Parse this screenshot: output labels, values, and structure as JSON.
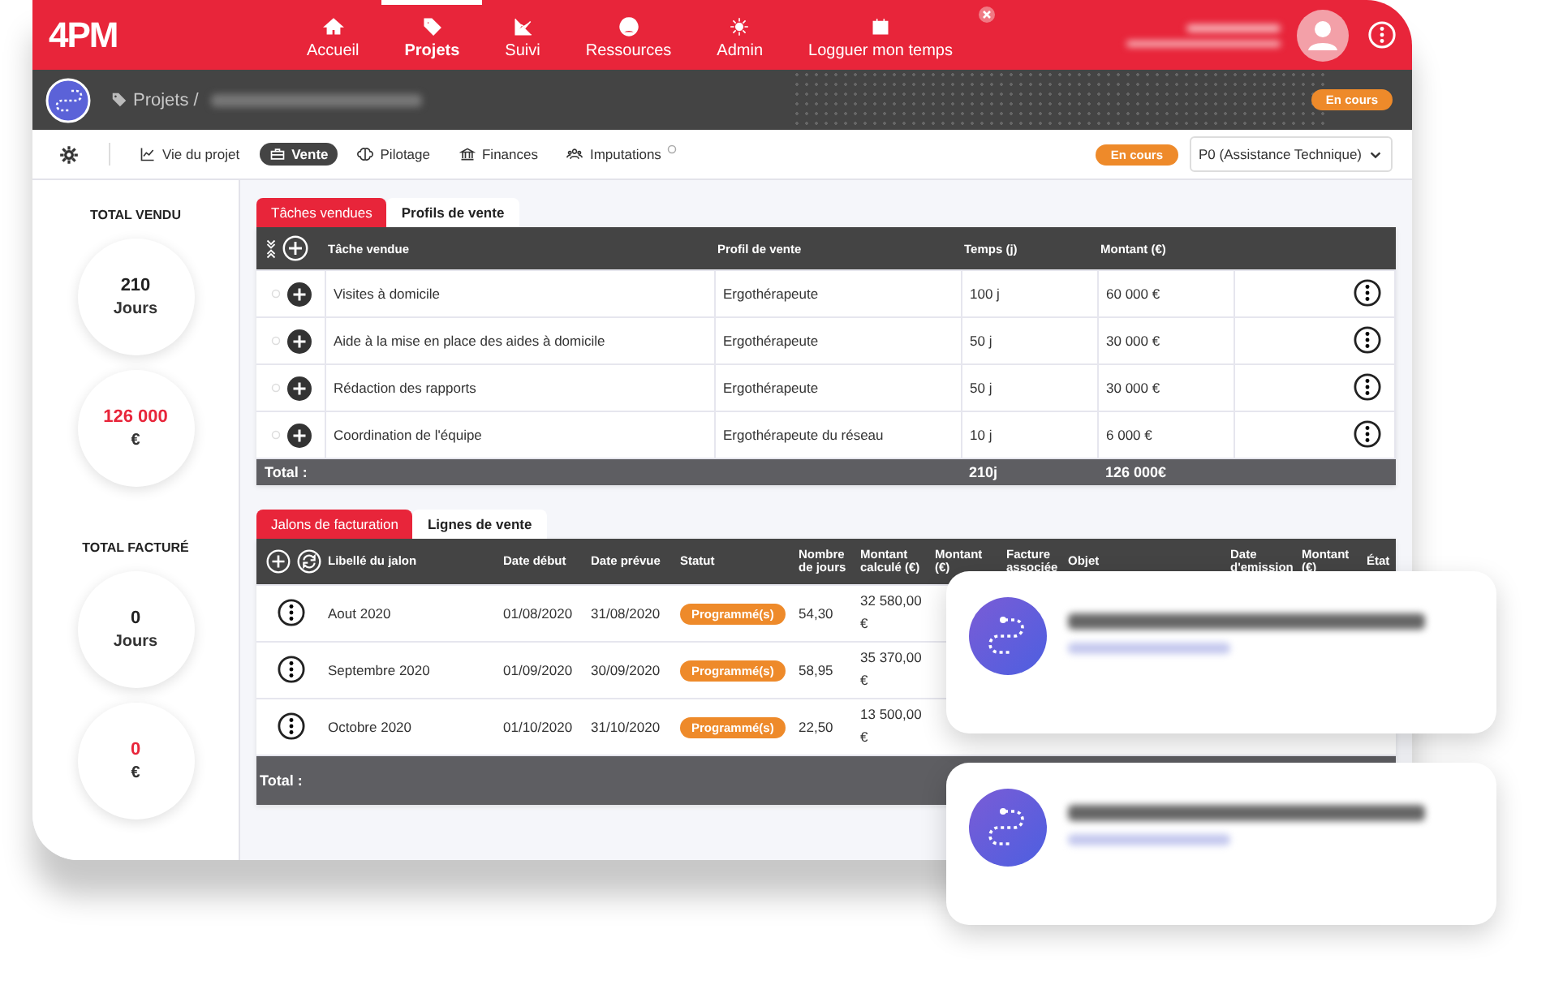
{
  "logo": "4PM",
  "nav": [
    {
      "label": "Accueil",
      "selected": false
    },
    {
      "label": "Projets",
      "selected": true
    },
    {
      "label": "Suivi",
      "selected": false
    },
    {
      "label": "Ressources",
      "selected": false
    },
    {
      "label": "Admin",
      "selected": false
    },
    {
      "label": "Logguer mon temps",
      "selected": false
    }
  ],
  "project_bar": {
    "breadcrumb": "Projets /",
    "status": "En cours"
  },
  "toolbar": {
    "tabs": [
      {
        "label": "Vie du projet",
        "selected": false
      },
      {
        "label": "Vente",
        "selected": true
      },
      {
        "label": "Pilotage",
        "selected": false
      },
      {
        "label": "Finances",
        "selected": false
      },
      {
        "label": "Imputations",
        "selected": false
      }
    ],
    "status": "En cours",
    "phase": "P0 (Assistance Technique)"
  },
  "sidebar": [
    {
      "title": "TOTAL VENDU",
      "stats": [
        {
          "value": "210",
          "unit": "Jours",
          "kind": "days"
        },
        {
          "value": "126 000",
          "unit": "€",
          "kind": "amount"
        }
      ]
    },
    {
      "title": "TOTAL FACTURÉ",
      "stats": [
        {
          "value": "0",
          "unit": "Jours",
          "kind": "days"
        },
        {
          "value": "0",
          "unit": "€",
          "kind": "amount"
        }
      ]
    }
  ],
  "sales": {
    "tabs": [
      {
        "label": "Tâches vendues",
        "selected": true
      },
      {
        "label": "Profils de vente",
        "selected": false
      }
    ],
    "columns": [
      "Tâche vendue",
      "Profil de vente",
      "Temps (j)",
      "Montant (€)"
    ],
    "rows": [
      {
        "task": "Visites à domicile",
        "profile": "Ergothérapeute",
        "time": "100 j",
        "amount": "60 000 €"
      },
      {
        "task": "Aide à la mise en place des aides à domicile",
        "profile": "Ergothérapeute",
        "time": "50 j",
        "amount": "30 000 €"
      },
      {
        "task": "Rédaction des rapports",
        "profile": "Ergothérapeute",
        "time": "50 j",
        "amount": "30 000 €"
      },
      {
        "task": "Coordination de l'équipe",
        "profile": "Ergothérapeute du réseau",
        "time": "10 j",
        "amount": "6 000 €"
      }
    ],
    "total": {
      "label": "Total :",
      "time": "210j",
      "amount": "126 000€"
    }
  },
  "billing": {
    "tabs": [
      {
        "label": "Jalons de facturation",
        "selected": true
      },
      {
        "label": "Lignes de vente",
        "selected": false
      }
    ],
    "columns": [
      "Libellé du jalon",
      "Date début",
      "Date prévue",
      "Statut",
      "Nombre de jours",
      "Montant calculé (€)",
      "Montant (€)",
      "Facture associée",
      "Objet",
      "Date d'emission",
      "Montant (€)",
      "État"
    ],
    "rows": [
      {
        "label": "Aout 2020",
        "start": "01/08/2020",
        "end": "31/08/2020",
        "status": "Programmé(s)",
        "days": "54,30",
        "computed": "32 580,00 €"
      },
      {
        "label": "Septembre 2020",
        "start": "01/09/2020",
        "end": "30/09/2020",
        "status": "Programmé(s)",
        "days": "58,95",
        "computed": "35 370,00 €"
      },
      {
        "label": "Octobre 2020",
        "start": "01/10/2020",
        "end": "31/10/2020",
        "status": "Programmé(s)",
        "days": "22,50",
        "computed": "13 500,00 €"
      }
    ],
    "total": {
      "label": "Total :"
    }
  },
  "floating_cards": [
    {
      "kind": "project"
    },
    {
      "kind": "project"
    }
  ]
}
